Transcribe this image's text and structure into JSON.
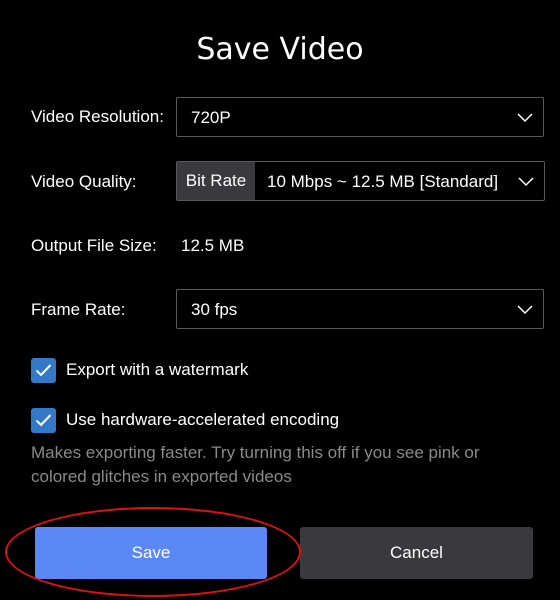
{
  "dialog": {
    "title": "Save Video"
  },
  "resolution": {
    "label": "Video Resolution:",
    "value": "720P"
  },
  "quality": {
    "label": "Video Quality:",
    "mode": "Bit Rate",
    "value": "10 Mbps ~ 12.5 MB [Standard]"
  },
  "file_size": {
    "label": "Output File Size:",
    "value": "12.5 MB"
  },
  "frame_rate": {
    "label": "Frame Rate:",
    "value": "30 fps"
  },
  "options": {
    "watermark": {
      "label": "Export with a watermark",
      "checked": true
    },
    "hardware": {
      "label": "Use hardware-accelerated encoding",
      "checked": true,
      "hint": "Makes exporting faster. Try turning this off if you see pink or colored glitches in exported videos"
    }
  },
  "buttons": {
    "save": "Save",
    "cancel": "Cancel"
  },
  "colors": {
    "background": "#000000",
    "accent": "#5c88f6",
    "checkbox": "#3478c8",
    "secondary_button": "#3a3a3c",
    "annotation": "#e01010"
  }
}
